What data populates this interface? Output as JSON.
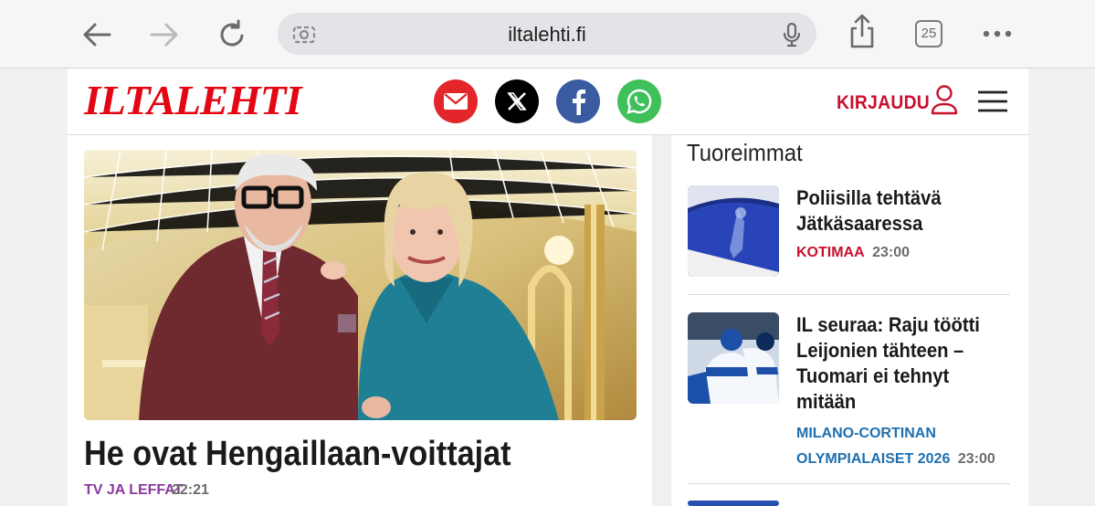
{
  "browser": {
    "url": "iltalehti.fi",
    "tab_count": "25",
    "icons": {
      "back": "back-arrow-icon",
      "forward": "forward-arrow-icon",
      "reload": "reload-icon",
      "camera": "camera-search-icon",
      "mic": "microphone-icon",
      "share": "share-icon",
      "more": "more-dots-icon"
    }
  },
  "header": {
    "logo": "ILTALEHTI",
    "login_label": "KIRJAUDU",
    "brand_color": "#e30613",
    "social": [
      {
        "name": "email",
        "color": "#e3262a"
      },
      {
        "name": "x",
        "color": "#000000"
      },
      {
        "name": "facebook",
        "color": "#3a5ba0"
      },
      {
        "name": "whatsapp",
        "color": "#3fc05a"
      }
    ]
  },
  "main": {
    "headline": "He ovat Hengaillaan-voittajat",
    "category": "TV JA LEFFAT",
    "category_color": "#8a3aa0",
    "time": "22:21"
  },
  "sidebar": {
    "title": "Tuoreimmat",
    "items": [
      {
        "title": "Poliisilla tehtävä Jätkäsaaressa",
        "category": "KOTIMAA",
        "time": "23:00"
      },
      {
        "title": "IL seuraa: Raju töötti Leijonien tähteen – Tuomari ei tehnyt mitään",
        "category_line1": "MILANO-CORTINAN",
        "category_line2": "OLYMPIALAISET 2026",
        "time": "23:00"
      }
    ]
  }
}
